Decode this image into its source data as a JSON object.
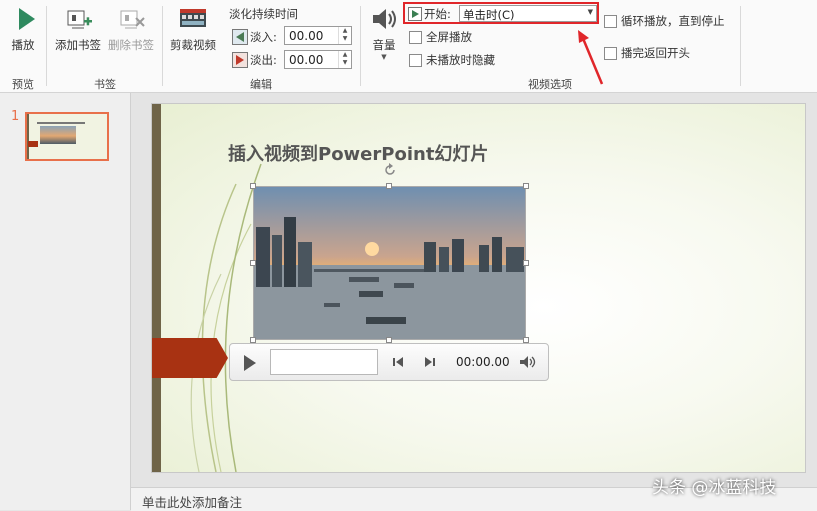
{
  "ribbon": {
    "preview": {
      "play_label": "播放",
      "group_label": "预览"
    },
    "bookmarks": {
      "add_label": "添加书签",
      "remove_label": "删除书签",
      "group_label": "书签"
    },
    "editing": {
      "trim_label": "剪裁视频",
      "fade_title": "淡化持续时间",
      "fade_in_label": "淡入:",
      "fade_in_value": "00.00",
      "fade_out_label": "淡出:",
      "fade_out_value": "00.00",
      "group_label": "编辑"
    },
    "video_options": {
      "volume_label": "音量",
      "start_label": "开始:",
      "start_value": "单击时(C)",
      "fullscreen_label": "全屏播放",
      "hide_label": "未播放时隐藏",
      "loop_label": "循环播放，直到停止",
      "rewind_label": "播完返回开头",
      "group_label": "视频选项"
    }
  },
  "thumbnails": [
    {
      "number": "1"
    }
  ],
  "slide": {
    "title": "插入视频到PowerPoint幻灯片"
  },
  "player": {
    "time": "00:00.00"
  },
  "notes": {
    "placeholder": "单击此处添加备注"
  },
  "watermark": "头条 @冰蓝科技",
  "colors": {
    "accent": "#e8704a",
    "highlight_box": "#e0262a",
    "slide_bar": "#6f6448",
    "tab_red": "#a83212"
  }
}
